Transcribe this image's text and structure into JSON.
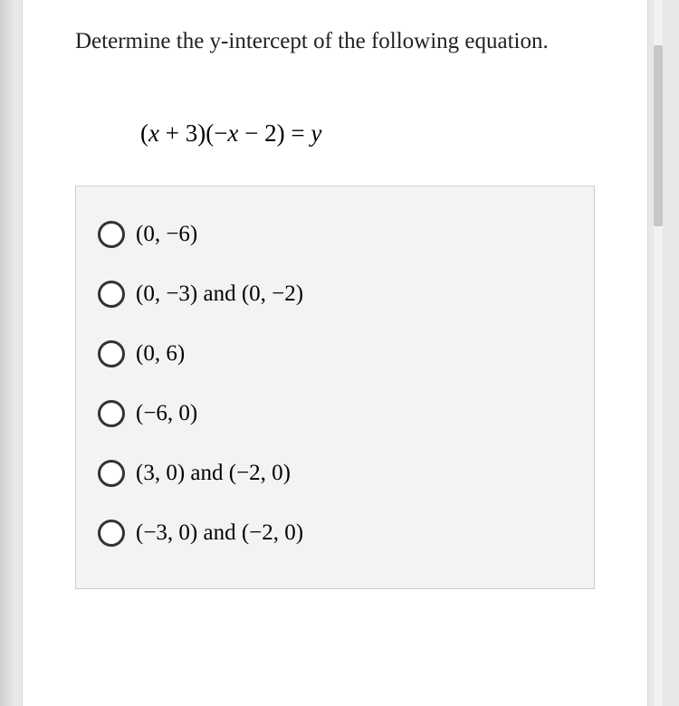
{
  "question": "Determine the y-intercept of the following equation.",
  "equation": "(x + 3)(−x − 2) = y",
  "options": [
    {
      "label": "(0, −6)"
    },
    {
      "label": "(0, −3) and (0, −2)"
    },
    {
      "label": "(0, 6)"
    },
    {
      "label": "(−6, 0)"
    },
    {
      "label": "(3, 0) and (−2, 0)"
    },
    {
      "label": "(−3, 0) and (−2, 0)"
    }
  ]
}
